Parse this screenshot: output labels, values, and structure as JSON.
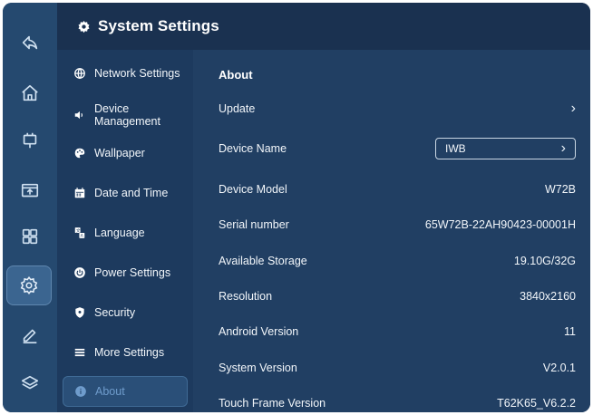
{
  "header": {
    "title": "System Settings",
    "icon": "gear-icon"
  },
  "rail": {
    "items": [
      {
        "icon": "back-icon"
      },
      {
        "icon": "home-icon"
      },
      {
        "icon": "monitor-icon"
      },
      {
        "icon": "screen-share-icon"
      },
      {
        "icon": "apps-grid-icon"
      },
      {
        "icon": "settings-gear-icon",
        "active": true
      },
      {
        "icon": "pen-icon"
      },
      {
        "icon": "layers-icon"
      }
    ]
  },
  "menu": {
    "items": [
      {
        "label": "Network Settings",
        "icon": "globe-icon"
      },
      {
        "label": "Device\nManagement",
        "icon": "speaker-icon"
      },
      {
        "label": "Wallpaper",
        "icon": "palette-icon"
      },
      {
        "label": "Date and Time",
        "icon": "calendar-icon"
      },
      {
        "label": "Language",
        "icon": "language-icon"
      },
      {
        "label": "Power Settings",
        "icon": "power-icon"
      },
      {
        "label": "Security",
        "icon": "shield-icon"
      },
      {
        "label": "More Settings",
        "icon": "list-icon"
      },
      {
        "label": "About",
        "icon": "info-icon",
        "active": true
      }
    ]
  },
  "about": {
    "title": "About",
    "update_label": "Update",
    "device_name_label": "Device Name",
    "device_name_value": "IWB",
    "rows": [
      {
        "label": "Device Model",
        "value": "W72B"
      },
      {
        "label": "Serial number",
        "value": "65W72B-22AH90423-00001H"
      },
      {
        "label": "Available Storage",
        "value": "19.10G/32G"
      },
      {
        "label": "Resolution",
        "value": "3840x2160"
      },
      {
        "label": "Android Version",
        "value": "11"
      },
      {
        "label": "System Version",
        "value": "V2.0.1"
      },
      {
        "label": "Touch Frame Version",
        "value": "T62K65_V6.2.2"
      }
    ]
  },
  "colors": {
    "background": "#1c3557",
    "rail": "#25496f",
    "content": "#213f63",
    "active_text": "#6f9ccc"
  }
}
